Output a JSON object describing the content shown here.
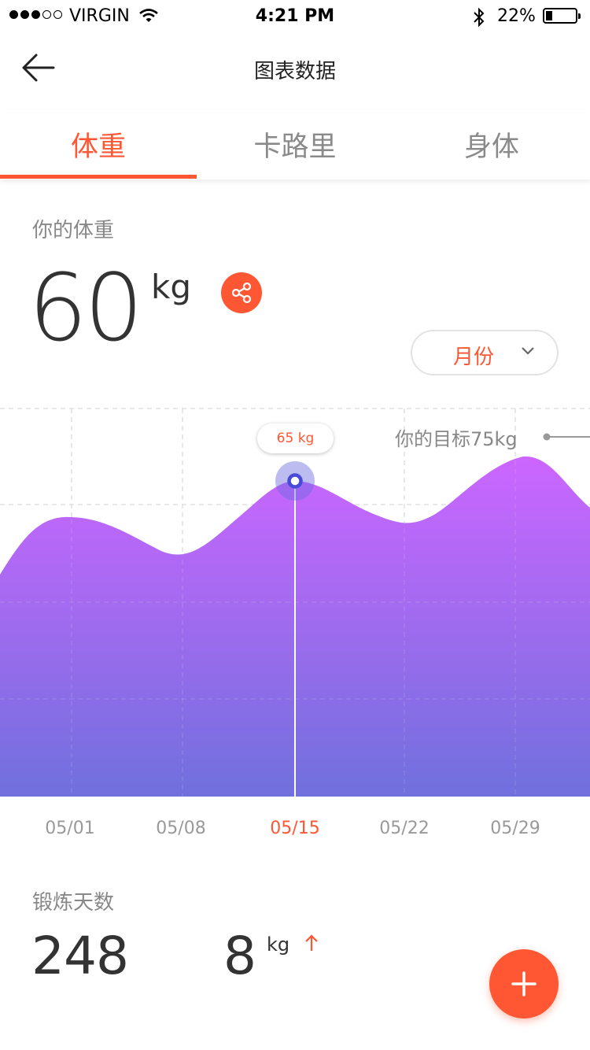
{
  "status_bar": {
    "carrier": "VIRGIN",
    "time": "4:21 PM",
    "battery_pct": "22%",
    "signal_bars_filled": 3,
    "signal_bars_total": 5,
    "battery_level": 0.22
  },
  "nav": {
    "title": "图表数据",
    "back_icon": "arrow-left-icon"
  },
  "tabs": [
    {
      "label": "体重",
      "active": true
    },
    {
      "label": "卡路里",
      "active": false
    },
    {
      "label": "身体",
      "active": false
    }
  ],
  "weight": {
    "label": "你的体重",
    "value": "60",
    "unit": "kg",
    "share_icon": "share-icon"
  },
  "period_select": {
    "value": "月份",
    "icon": "chevron-down-icon"
  },
  "chart": {
    "tooltip": "65 kg",
    "goal_label": "你的目标75kg",
    "x_labels": [
      "05/01",
      "05/08",
      "05/15",
      "05/22",
      "05/29"
    ],
    "active_index": 2
  },
  "stats": {
    "days_label": "锻炼天数",
    "days_value": "248",
    "delta_value": "8",
    "delta_unit": "kg",
    "delta_icon": "arrow-up-icon"
  },
  "fab": {
    "icon": "plus-icon"
  },
  "colors": {
    "accent": "#ff5733",
    "area_top": "#cc66ff",
    "area_bottom": "#7070dd",
    "marker": "#4a4ad8"
  }
}
